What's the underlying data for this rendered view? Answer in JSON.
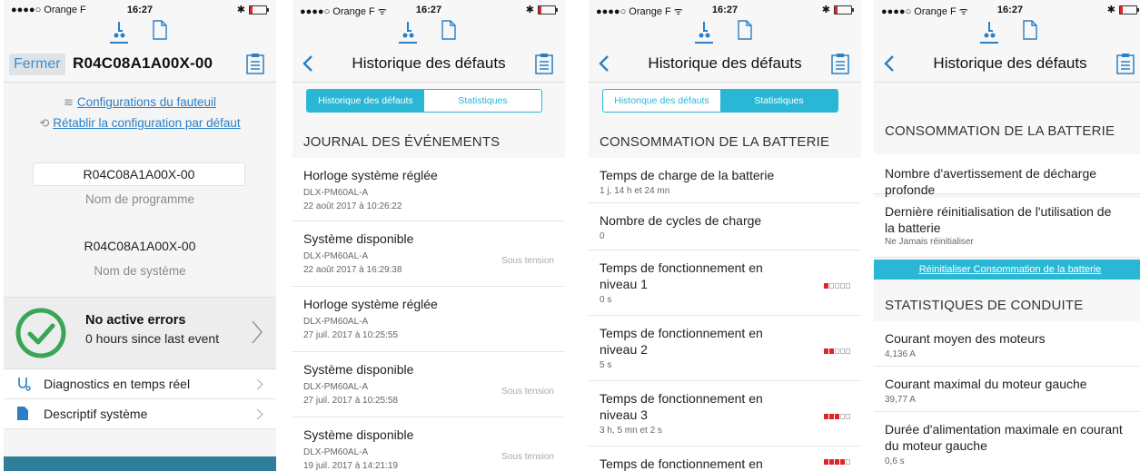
{
  "status_bar": {
    "carrier": "●●●●○ Orange F",
    "carrier_short": "●●●●○ Orange F ᯤ",
    "time": "16:27"
  },
  "icons": {
    "chair": "wheelchair-icon",
    "doc": "document-icon",
    "clipboard": "clipboard-icon"
  },
  "colors": {
    "accent": "#2ab7d6",
    "link": "#2a7fc7",
    "success": "#3aa655",
    "level_on": "#e0242a"
  },
  "screen1": {
    "close_label": "Fermer",
    "title": "R04C08A1A00X-00",
    "link_config": "Configurations du fauteuil",
    "link_reset": "Rétablir la configuration par défaut",
    "program_value": "R04C08A1A00X-00",
    "program_caption": "Nom de programme",
    "system_value": "R04C08A1A00X-00",
    "system_caption": "Nom de système",
    "status_title": "No active errors",
    "status_sub": "0 hours since last event",
    "menu": [
      {
        "label": "Diagnostics en temps réel"
      },
      {
        "label": "Descriptif système"
      }
    ]
  },
  "screen2": {
    "title": "Historique des défauts",
    "tabs": [
      "Historique des défauts",
      "Statistiques"
    ],
    "section": "JOURNAL DES ÉVÉNEMENTS",
    "events": [
      {
        "title": "Horloge système réglée",
        "device": "DLX-PM60AL-A",
        "date": "22 août 2017 à 10:26:22",
        "status": ""
      },
      {
        "title": "Système disponible",
        "device": "DLX-PM60AL-A",
        "date": "22 août 2017 à 16:29:38",
        "status": "Sous tension"
      },
      {
        "title": "Horloge système réglée",
        "device": "DLX-PM60AL-A",
        "date": "27 juil. 2017 à 10:25:55",
        "status": ""
      },
      {
        "title": "Système disponible",
        "device": "DLX-PM60AL-A",
        "date": "27 juil. 2017 à 10:25:58",
        "status": "Sous tension"
      },
      {
        "title": "Système disponible",
        "device": "DLX-PM60AL-A",
        "date": "19 juil. 2017 à 14:21:19",
        "status": "Sous tension"
      }
    ]
  },
  "screen3": {
    "title": "Historique des défauts",
    "tabs": [
      "Historique des défauts",
      "Statistiques"
    ],
    "section": "CONSOMMATION DE LA BATTERIE",
    "items": [
      {
        "title": "Temps de charge de la batterie",
        "value": "1 j, 14 h et 24 mn",
        "level": 0
      },
      {
        "title": "Nombre de cycles de charge",
        "value": "0",
        "level": 0
      },
      {
        "title": "Temps de fonctionnement en niveau 1",
        "value": "0 s",
        "level": 1
      },
      {
        "title": "Temps de fonctionnement en niveau 2",
        "value": "5 s",
        "level": 2
      },
      {
        "title": "Temps de fonctionnement en niveau 3",
        "value": "3 h, 5 mn et 2 s",
        "level": 3
      },
      {
        "title": "Temps de fonctionnement en",
        "value": "",
        "level": 4
      }
    ]
  },
  "screen4": {
    "title": "Historique des défauts",
    "section1": "CONSOMMATION DE LA BATTERIE",
    "items1": [
      {
        "title": "Nombre d'avertissement de décharge profonde",
        "value": "0"
      },
      {
        "title": "Dernière réinitialisation de l'utilisation de la batterie",
        "value": "Ne Jamais réinitialiser"
      }
    ],
    "reset_label": "Réinitialiser Consommation de la batterie",
    "section2": "STATISTIQUES DE CONDUITE",
    "items2": [
      {
        "title": "Courant moyen des moteurs",
        "value": "4,136 A"
      },
      {
        "title": "Courant maximal du moteur gauche",
        "value": "39,77 A"
      },
      {
        "title": "Durée d'alimentation maximale en courant du moteur gauche",
        "value": "0,6 s"
      }
    ]
  }
}
